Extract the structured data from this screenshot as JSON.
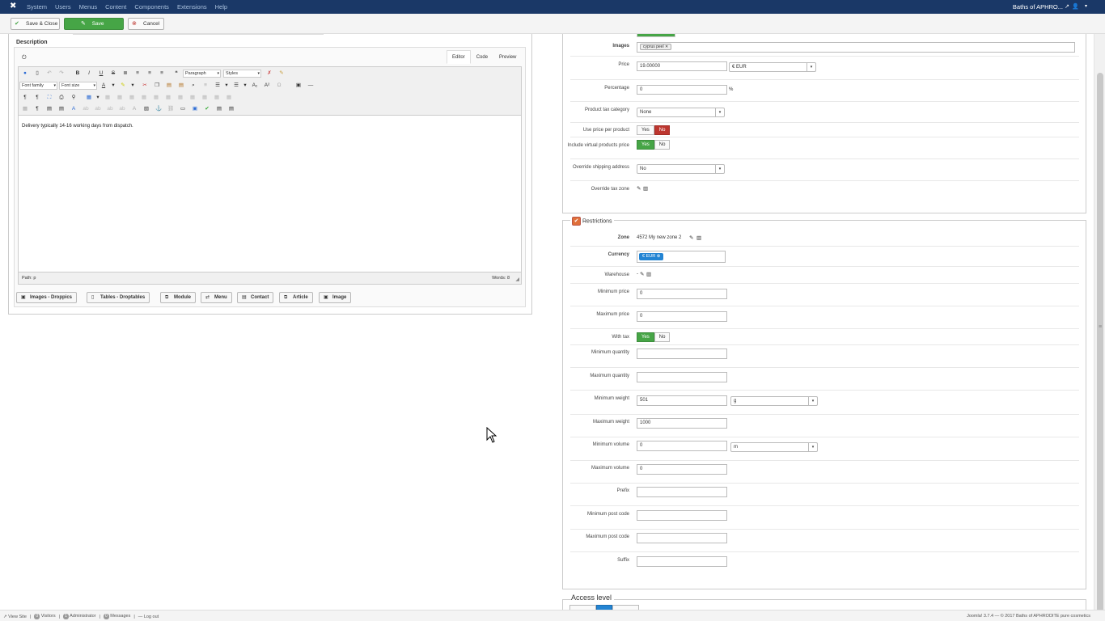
{
  "topbar": {
    "logo": "✖",
    "menu": [
      "System",
      "Users",
      "Menus",
      "Content",
      "Components",
      "Extensions",
      "Help"
    ],
    "site_name": "Baths of APHRO...",
    "external_icon": "↗",
    "user_icon": "👤",
    "caret": "▾"
  },
  "toolbar": {
    "save_close": "Save & Close",
    "save": "Save",
    "cancel": "Cancel"
  },
  "description": {
    "label": "Description",
    "tabs": [
      "Editor",
      "Code",
      "Preview"
    ],
    "paragraph_select": "Paragraph",
    "styles_select": "Styles",
    "font_family": "Font family",
    "font_size": "Font size",
    "content": "Delivery typically 14-16 working days from dispatch.",
    "path": "Path: p",
    "words": "Words: 8"
  },
  "editor_buttons": [
    "Images - Droppics",
    "Tables - Droptables",
    "Module",
    "Menu",
    "Contact",
    "Article",
    "Image"
  ],
  "price_form": {
    "images_label": "Images",
    "images_tag": "cyprus peel",
    "price_label": "Price",
    "price_value": "19.00000",
    "currency_value": "€ EUR",
    "percentage_label": "Percentage",
    "percentage_value": "0",
    "percentage_suffix": "%",
    "tax_category_label": "Product tax category",
    "tax_category_value": "None",
    "use_price_label": "Use price per product",
    "include_virtual_label": "Include virtual products price",
    "override_shipping_label": "Override shipping address",
    "override_shipping_value": "No",
    "override_tax_label": "Override tax zone",
    "yes": "Yes",
    "no": "No"
  },
  "restrictions": {
    "legend": "Restrictions",
    "zone_label": "Zone",
    "zone_value": "4572 My new zone 2",
    "currency_label": "Currency",
    "currency_tag": "€ EUR",
    "warehouse_label": "Warehouse",
    "warehouse_value": "-",
    "min_price_label": "Minimum price",
    "min_price_value": "0",
    "max_price_label": "Maximum price",
    "max_price_value": "0",
    "with_tax_label": "With tax",
    "min_qty_label": "Minimum quantity",
    "max_qty_label": "Maximum quantity",
    "min_weight_label": "Minimum weight",
    "min_weight_value": "501",
    "weight_unit": "g",
    "max_weight_label": "Maximum weight",
    "max_weight_value": "1000",
    "min_volume_label": "Minimum volume",
    "min_volume_value": "0",
    "volume_unit": "m",
    "max_volume_label": "Maximum volume",
    "max_volume_value": "0",
    "prefix_label": "Prefix",
    "min_post_label": "Minimum post code",
    "max_post_label": "Maximum post code",
    "suffix_label": "Suffix"
  },
  "access_level": {
    "legend": "Access level"
  },
  "footer": {
    "view_site": "View Site",
    "visitors_count": "0",
    "visitors": "Visitors",
    "admin_count": "1",
    "admin": "Administrator",
    "messages_count": "0",
    "messages": "Messages",
    "logout": "Log out",
    "copyright": "Joomla! 3.7.4 — © 2017 Baths of APHRODITE pure cosmetics"
  }
}
